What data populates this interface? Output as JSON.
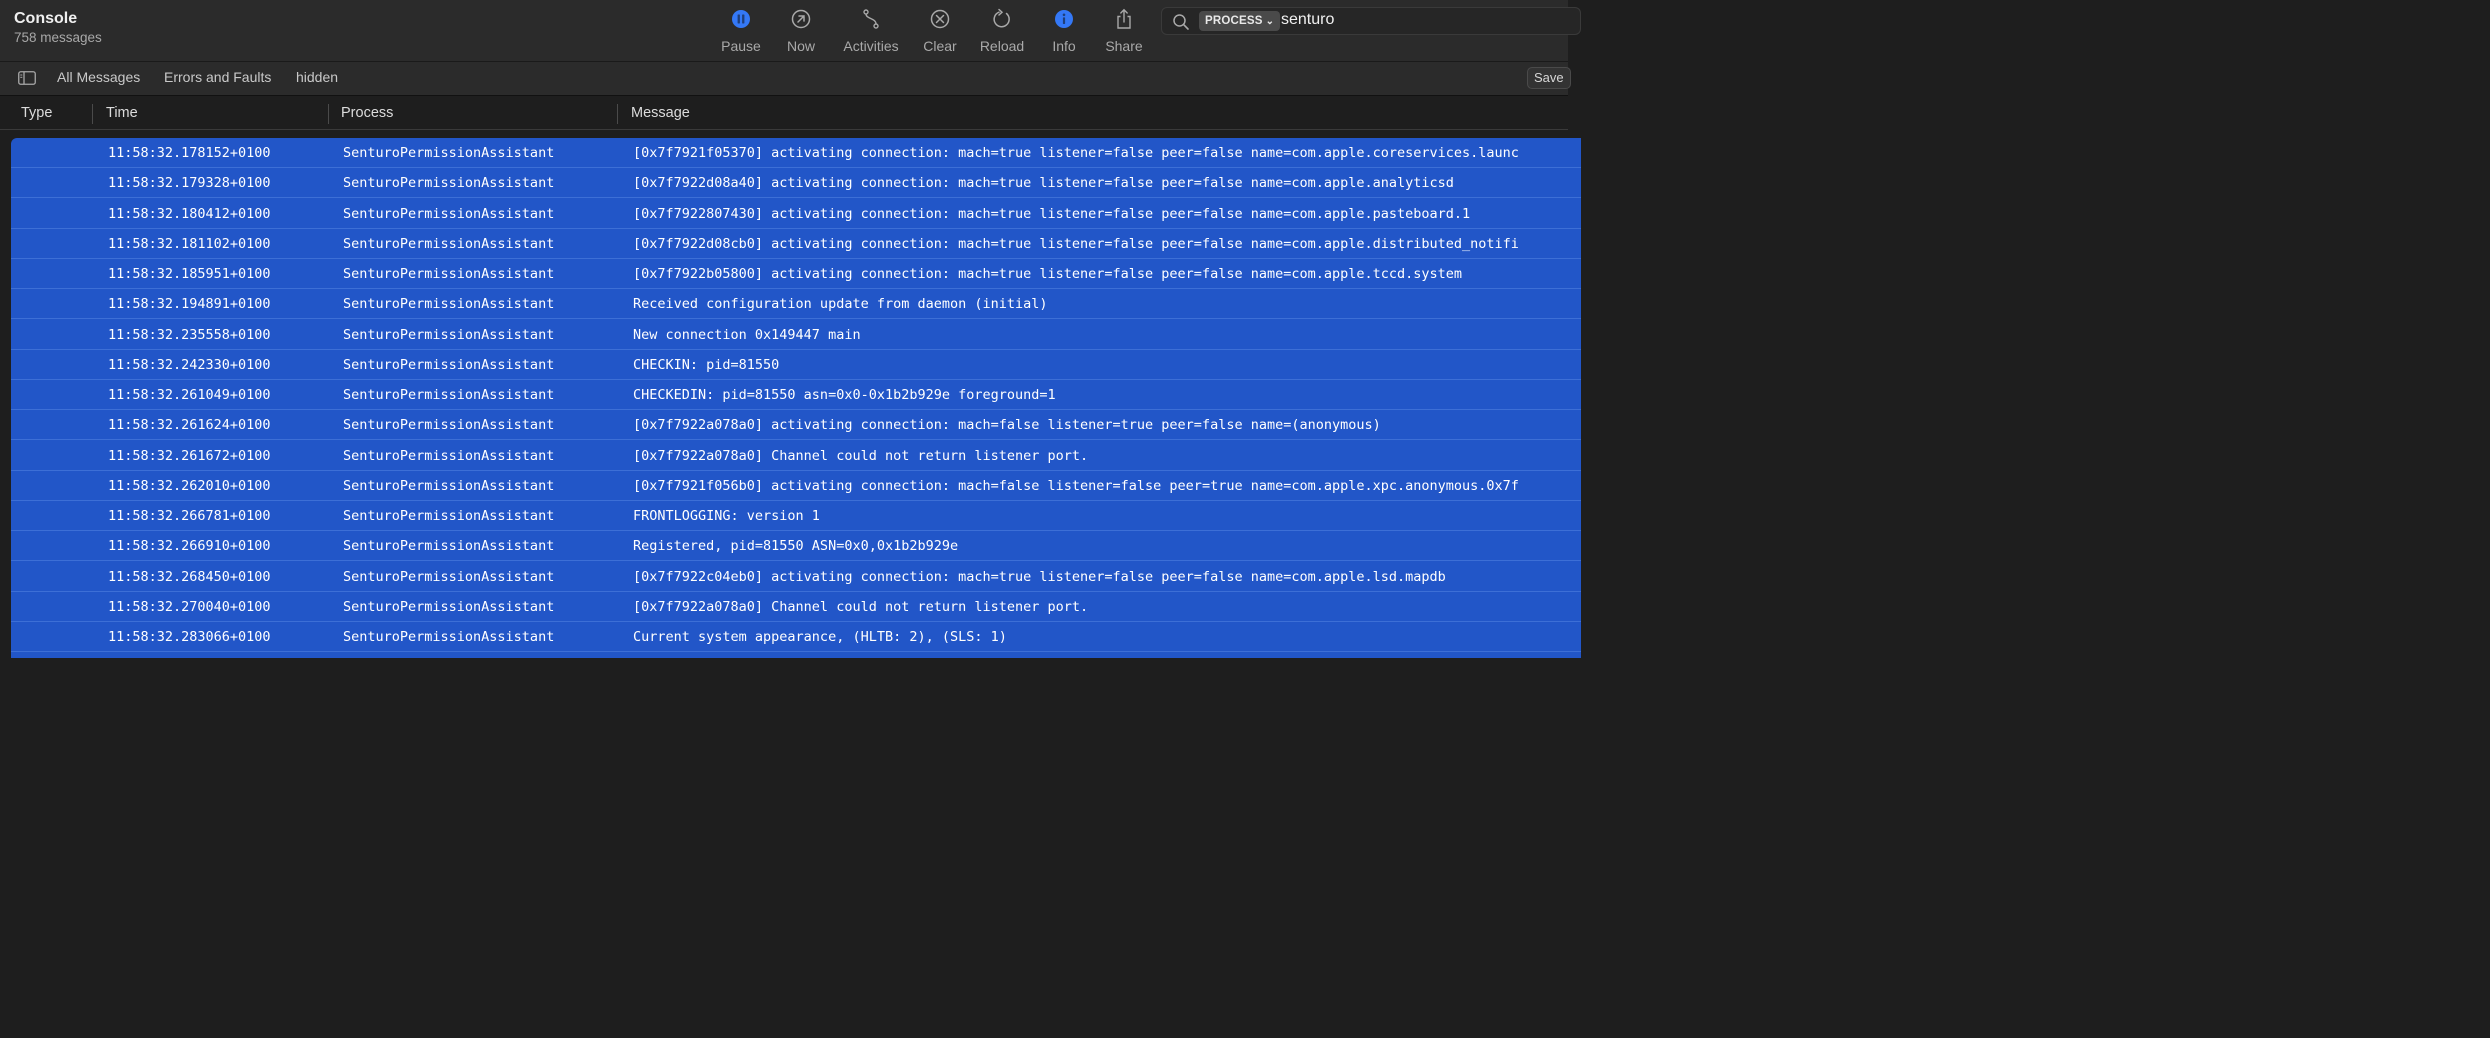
{
  "app": {
    "title": "Console",
    "message_count": "758 messages"
  },
  "toolbar": {
    "pause": "Pause",
    "now": "Now",
    "activities": "Activities",
    "clear": "Clear",
    "reload": "Reload",
    "info": "Info",
    "share": "Share",
    "accent": "#3478f6"
  },
  "search": {
    "token": "PROCESS",
    "value": "senturo"
  },
  "filters": {
    "all": "All Messages",
    "errors": "Errors and Faults",
    "hidden": "hidden",
    "save": "Save"
  },
  "columns": {
    "type": "Type",
    "time": "Time",
    "process": "Process",
    "message": "Message"
  },
  "selection_color": "#2256c8",
  "rows": [
    {
      "time": "11:58:32.178152+0100",
      "process": "SenturoPermissionAssistant",
      "message": "[0x7f7921f05370] activating connection: mach=true listener=false peer=false name=com.apple.coreservices.launc"
    },
    {
      "time": "11:58:32.179328+0100",
      "process": "SenturoPermissionAssistant",
      "message": "[0x7f7922d08a40] activating connection: mach=true listener=false peer=false name=com.apple.analyticsd"
    },
    {
      "time": "11:58:32.180412+0100",
      "process": "SenturoPermissionAssistant",
      "message": "[0x7f7922807430] activating connection: mach=true listener=false peer=false name=com.apple.pasteboard.1"
    },
    {
      "time": "11:58:32.181102+0100",
      "process": "SenturoPermissionAssistant",
      "message": "[0x7f7922d08cb0] activating connection: mach=true listener=false peer=false name=com.apple.distributed_notifi"
    },
    {
      "time": "11:58:32.185951+0100",
      "process": "SenturoPermissionAssistant",
      "message": "[0x7f7922b05800] activating connection: mach=true listener=false peer=false name=com.apple.tccd.system"
    },
    {
      "time": "11:58:32.194891+0100",
      "process": "SenturoPermissionAssistant",
      "message": "Received configuration update from daemon (initial)"
    },
    {
      "time": "11:58:32.235558+0100",
      "process": "SenturoPermissionAssistant",
      "message": "New connection 0x149447 main"
    },
    {
      "time": "11:58:32.242330+0100",
      "process": "SenturoPermissionAssistant",
      "message": "CHECKIN: pid=81550"
    },
    {
      "time": "11:58:32.261049+0100",
      "process": "SenturoPermissionAssistant",
      "message": "CHECKEDIN: pid=81550 asn=0x0-0x1b2b929e foreground=1"
    },
    {
      "time": "11:58:32.261624+0100",
      "process": "SenturoPermissionAssistant",
      "message": "[0x7f7922a078a0] activating connection: mach=false listener=true peer=false name=(anonymous)"
    },
    {
      "time": "11:58:32.261672+0100",
      "process": "SenturoPermissionAssistant",
      "message": "[0x7f7922a078a0] Channel could not return listener port."
    },
    {
      "time": "11:58:32.262010+0100",
      "process": "SenturoPermissionAssistant",
      "message": "[0x7f7921f056b0] activating connection: mach=false listener=false peer=true name=com.apple.xpc.anonymous.0x7f"
    },
    {
      "time": "11:58:32.266781+0100",
      "process": "SenturoPermissionAssistant",
      "message": "FRONTLOGGING: version 1"
    },
    {
      "time": "11:58:32.266910+0100",
      "process": "SenturoPermissionAssistant",
      "message": "Registered, pid=81550 ASN=0x0,0x1b2b929e"
    },
    {
      "time": "11:58:32.268450+0100",
      "process": "SenturoPermissionAssistant",
      "message": "[0x7f7922c04eb0] activating connection: mach=true listener=false peer=false name=com.apple.lsd.mapdb"
    },
    {
      "time": "11:58:32.270040+0100",
      "process": "SenturoPermissionAssistant",
      "message": "[0x7f7922a078a0] Channel could not return listener port."
    },
    {
      "time": "11:58:32.283066+0100",
      "process": "SenturoPermissionAssistant",
      "message": "Current system appearance, (HLTB: 2), (SLS: 1)"
    }
  ]
}
